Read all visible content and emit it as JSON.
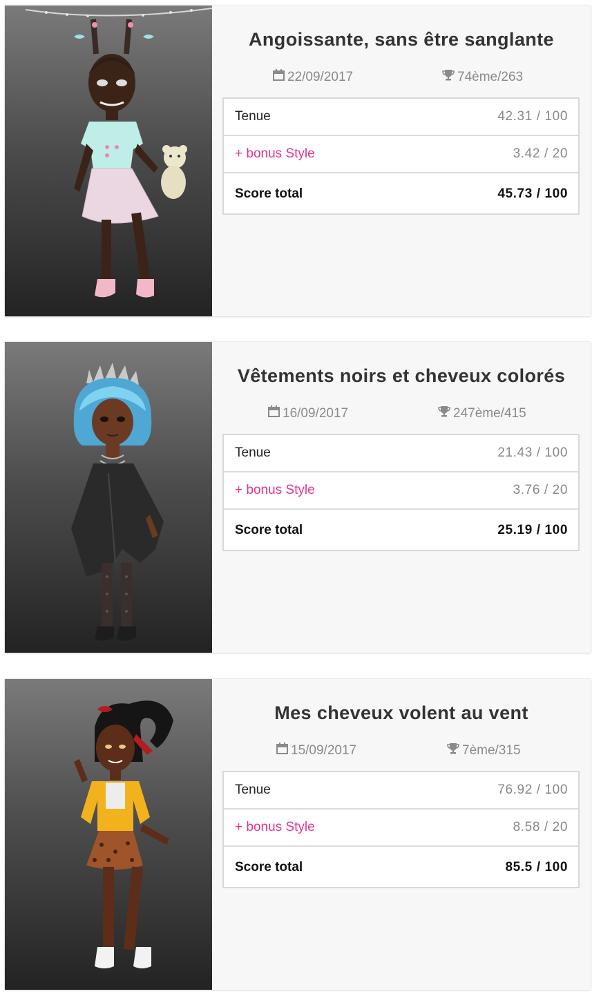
{
  "cards": [
    {
      "title": "Angoissante, sans être sanglante",
      "date": "22/09/2017",
      "rank": "74ème/263",
      "rows": [
        {
          "label": "Tenue",
          "value": "42.31 / 100"
        },
        {
          "label": "+ bonus Style",
          "value": "3.42 / 20"
        },
        {
          "label": "Score total",
          "value": "45.73 / 100"
        }
      ]
    },
    {
      "title": "Vêtements noirs et cheveux colorés",
      "date": "16/09/2017",
      "rank": "247ème/415",
      "rows": [
        {
          "label": "Tenue",
          "value": "21.43 / 100"
        },
        {
          "label": "+ bonus Style",
          "value": "3.76 / 20"
        },
        {
          "label": "Score total",
          "value": "25.19 / 100"
        }
      ]
    },
    {
      "title": "Mes cheveux volent au vent",
      "date": "15/09/2017",
      "rank": "7ème/315",
      "rows": [
        {
          "label": "Tenue",
          "value": "76.92 / 100"
        },
        {
          "label": "+ bonus Style",
          "value": "8.58 / 20"
        },
        {
          "label": "Score total",
          "value": "85.5 / 100"
        }
      ]
    }
  ],
  "icons": {
    "date": "calendar-icon",
    "rank": "trophy-icon"
  },
  "colors": {
    "bonus": "#e0358d",
    "muted": "#888888",
    "title": "#333333",
    "card_bg": "#f7f7f7"
  }
}
